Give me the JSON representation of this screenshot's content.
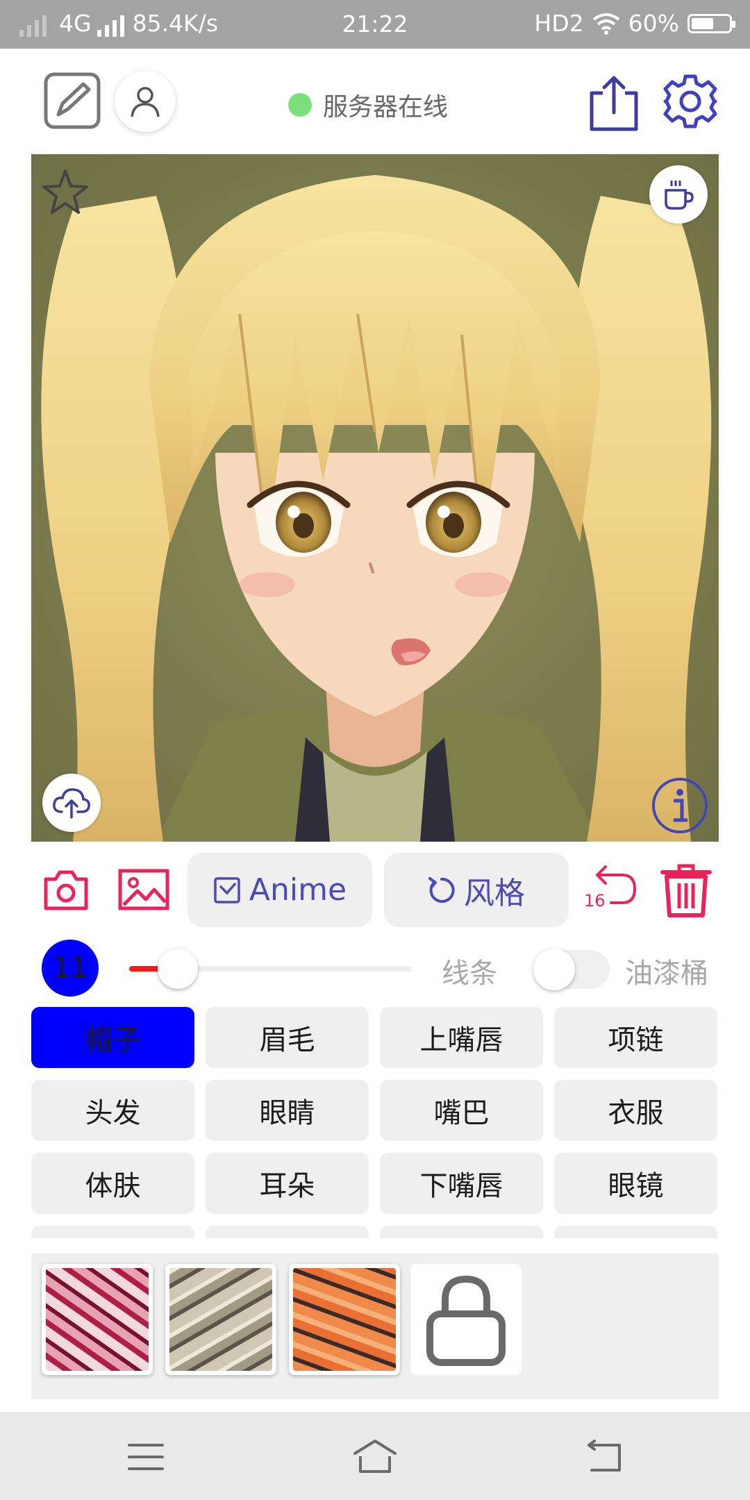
{
  "status_bar": {
    "network": "4G",
    "speed": "85.4K/s",
    "time": "21:22",
    "hd": "HD2",
    "battery_text": "60%",
    "battery_level": 0.6
  },
  "header": {
    "server_status": "服务器在线",
    "server_status_color": "#7be07b",
    "icons": [
      "edit-icon",
      "user-icon",
      "share-icon",
      "settings-icon"
    ]
  },
  "canvas": {
    "overlay_icons": [
      "star-icon",
      "coffee-icon",
      "cloud-upload-icon",
      "info-icon"
    ]
  },
  "tools": {
    "model_label": "Anime",
    "style_label": "风格",
    "undo_count": "16"
  },
  "brush": {
    "size": "11",
    "slider_value": 0.12,
    "line_label": "线条",
    "bucket_label": "油漆桶",
    "bucket_on": false
  },
  "parts": {
    "selected": "帽子",
    "accent_color": "#0000ff",
    "items": [
      "帽子",
      "眉毛",
      "上嘴唇",
      "项链",
      "头发",
      "眼睛",
      "嘴巴",
      "衣服",
      "体肤",
      "耳朵",
      "下嘴唇",
      "眼镜"
    ]
  },
  "palette": {
    "textures": [
      "pink-texture",
      "grey-texture",
      "orange-texture"
    ],
    "locked_icon": "lock-icon"
  },
  "nav": {
    "icons": [
      "menu-icon",
      "home-icon",
      "back-icon"
    ]
  }
}
